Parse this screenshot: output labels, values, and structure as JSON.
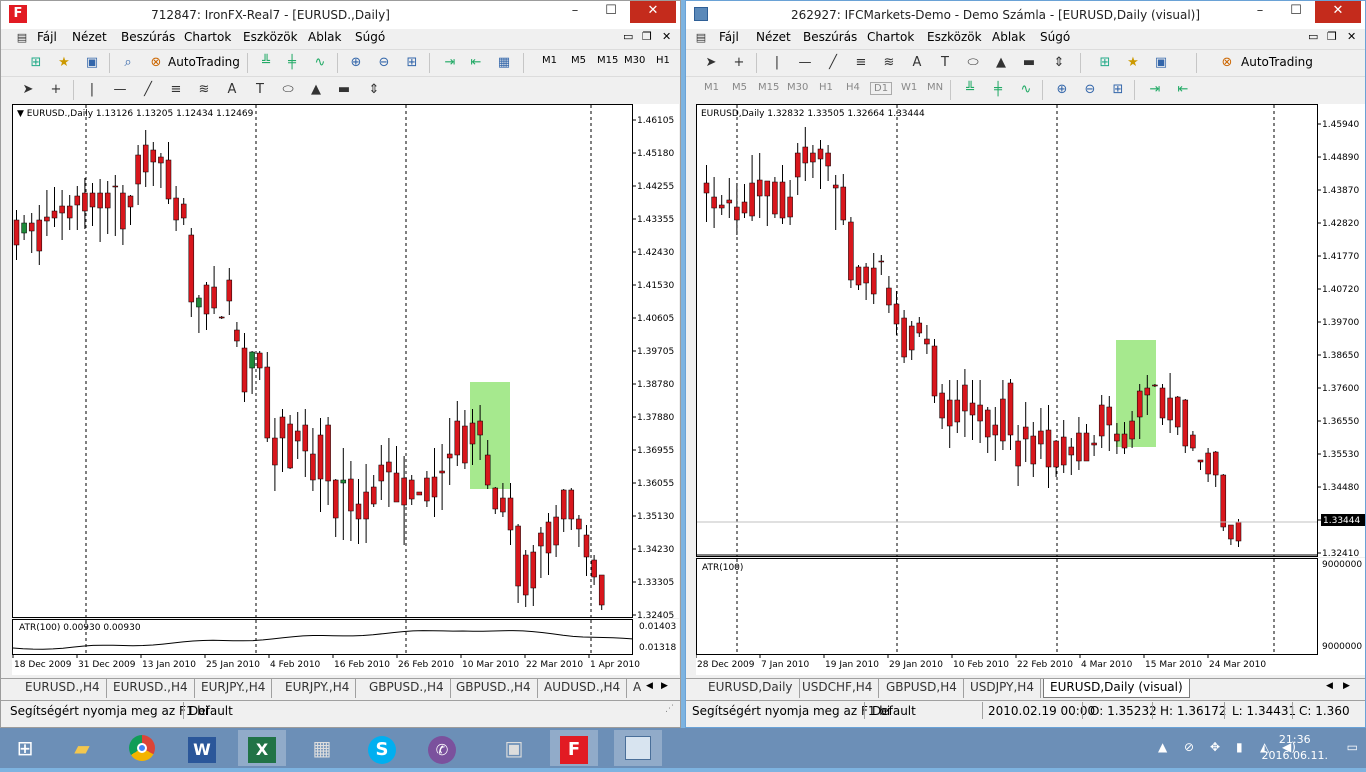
{
  "left_window": {
    "title": "712847: IronFX-Real7 - [EURUSD.,Daily]",
    "menu": [
      "Fájl",
      "Nézet",
      "Beszúrás",
      "Chartok",
      "Eszközök",
      "Ablak",
      "Súgó"
    ],
    "autotrading": "AutoTrading",
    "timeframes": [
      "M1",
      "M5",
      "M15",
      "M30",
      "H1"
    ],
    "chart_header": "EURUSD.,Daily  1.13126 1.13205 1.12434 1.12469",
    "atr_header": "ATR(100) 0.00930 0.00930",
    "price_ticks": [
      "1.46105",
      "1.45180",
      "1.44255",
      "1.43355",
      "1.42430",
      "1.41530",
      "1.40605",
      "1.39705",
      "1.38780",
      "1.37880",
      "1.36955",
      "1.36055",
      "1.35130",
      "1.34230",
      "1.33305",
      "1.32405"
    ],
    "atr_ticks": [
      "0.01403",
      "0.01318"
    ],
    "date_labels": [
      "18 Dec 2009",
      "31 Dec 2009",
      "13 Jan 2010",
      "25 Jan 2010",
      "4 Feb 2010",
      "16 Feb 2010",
      "26 Feb 2010",
      "10 Mar 2010",
      "22 Mar 2010",
      "1 Apr 2010"
    ],
    "tabs": [
      "EURUSD.,H4",
      "EURUSD.,H4",
      "EURJPY.,H4",
      "EURJPY.,H4",
      "GBPUSD.,H4",
      "GBPUSD.,H4",
      "AUDUSD.,H4",
      "A"
    ],
    "status_help": "Segítségért nyomja meg az F1 bi",
    "status_profile": "Default"
  },
  "right_window": {
    "title": "262927: IFCMarkets-Demo - Demo Számla - [EURUSD,Daily (visual)]",
    "menu": [
      "Fájl",
      "Nézet",
      "Beszúrás",
      "Chartok",
      "Eszközök",
      "Ablak",
      "Súgó"
    ],
    "autotrading": "AutoTrading",
    "timeframes": [
      "M1",
      "M5",
      "M15",
      "M30",
      "H1",
      "H4",
      "D1",
      "W1",
      "MN"
    ],
    "chart_header": "EURUSD,Daily  1.32832 1.33505 1.32664 1.33444",
    "atr_header": "ATR(100)",
    "price_ticks": [
      "1.45940",
      "1.44890",
      "1.43870",
      "1.42820",
      "1.41770",
      "1.40720",
      "1.39700",
      "1.38650",
      "1.37600",
      "1.36550",
      "1.35530",
      "1.34480",
      "1.33444",
      "1.32410"
    ],
    "current_price": "1.33444",
    "atr_ticks": [
      "9000000",
      "9000000"
    ],
    "date_labels": [
      "28 Dec 2009",
      "7 Jan 2010",
      "19 Jan 2010",
      "29 Jan 2010",
      "10 Feb 2010",
      "22 Feb 2010",
      "4 Mar 2010",
      "15 Mar 2010",
      "24 Mar 2010"
    ],
    "tabs": [
      "EURUSD,Daily",
      "USDCHF,H4",
      "GBPUSD,H4",
      "USDJPY,H4",
      "EURUSD,Daily (visual)"
    ],
    "status_help": "Segítségért nyomja meg az F1 bi",
    "status_profile": "Default",
    "status_date": "2010.02.19 00:00",
    "status_open": "O: 1.35232",
    "status_high": "H: 1.36172",
    "status_low": "L: 1.34431",
    "status_close": "C: 1.360"
  },
  "taskbar": {
    "time": "21:36",
    "date": "2016.06.11."
  },
  "colors": {
    "bull": "#1e8a3a",
    "bear": "#d8161c",
    "highlight": "#a6e98e"
  }
}
